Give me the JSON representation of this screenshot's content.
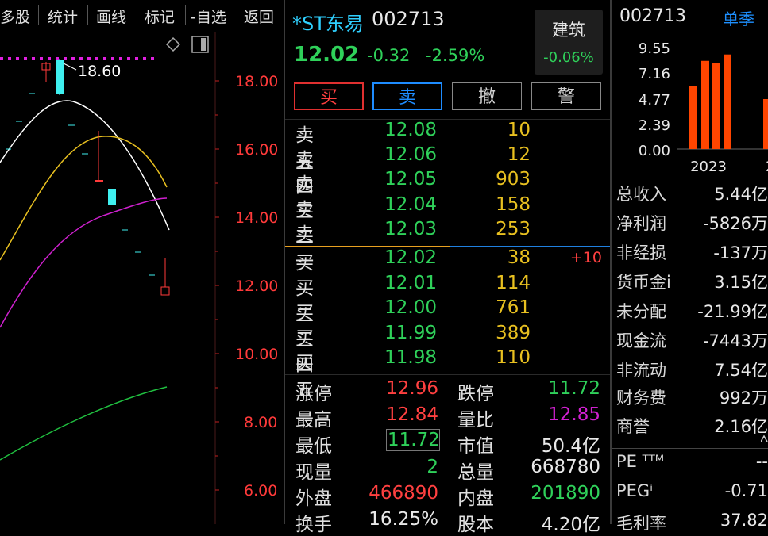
{
  "toolbar": {
    "items": [
      "多股",
      "统计",
      "画线",
      "标记",
      "-自选",
      "返回"
    ]
  },
  "kline": {
    "high_marker": "18.60",
    "y_labels": [
      "18.00",
      "16.00",
      "14.00",
      "12.00",
      "10.00",
      "8.00",
      "6.00"
    ],
    "colors": {
      "up": "#ff3a3a",
      "down": "#3ff0f0",
      "ma5": "#ffffff",
      "ma10": "#e8c020",
      "ma20": "#d020d0",
      "ma60": "#20c040",
      "limit": "#e020e0"
    }
  },
  "quote": {
    "name": "*ST东易",
    "code": "002713",
    "price": "12.02",
    "change": "-0.32",
    "change_pct": "-2.59%",
    "sector_name": "建筑",
    "sector_change": "-0.06%"
  },
  "buttons": {
    "buy": "买",
    "sell": "卖",
    "cancel": "撤",
    "alert": "警"
  },
  "asks": [
    {
      "label": "卖五",
      "price": "12.08",
      "vol": "10"
    },
    {
      "label": "卖四",
      "price": "12.06",
      "vol": "12"
    },
    {
      "label": "卖三",
      "price": "12.05",
      "vol": "903"
    },
    {
      "label": "卖二",
      "price": "12.04",
      "vol": "158"
    },
    {
      "label": "卖一",
      "price": "12.03",
      "vol": "253"
    }
  ],
  "bids": [
    {
      "label": "买一",
      "price": "12.02",
      "vol": "38",
      "delta": "+10"
    },
    {
      "label": "买二",
      "price": "12.01",
      "vol": "114",
      "delta": ""
    },
    {
      "label": "买三",
      "price": "12.00",
      "vol": "761",
      "delta": ""
    },
    {
      "label": "买四",
      "price": "11.99",
      "vol": "389",
      "delta": ""
    },
    {
      "label": "买五",
      "price": "11.98",
      "vol": "110",
      "delta": ""
    }
  ],
  "stats": {
    "limit_up_label": "涨停",
    "limit_up": "12.96",
    "limit_down_label": "跌停",
    "limit_down": "11.72",
    "high_label": "最高",
    "high": "12.84",
    "vol_ratio_label": "量比",
    "vol_ratio": "12.85",
    "low_label": "最低",
    "low": "11.72",
    "mktcap_label": "市值",
    "mktcap": "50.4亿",
    "cur_vol_label": "现量",
    "cur_vol": "2",
    "total_vol_label": "总量",
    "total_vol": "668780",
    "outer_label": "外盘",
    "outer": "466890",
    "inner_label": "内盘",
    "inner": "201890",
    "turnover_label": "换手",
    "turnover": "16.25%",
    "equity_label": "股本",
    "equity": "4.20亿"
  },
  "right_panel": {
    "code": "002713",
    "tab": "单季",
    "bar_y_labels": [
      "9.55",
      "7.16",
      "4.77",
      "2.39",
      "0.00"
    ],
    "bar_x_label": "2023",
    "bar_color": "#ff4500",
    "bar_values": [
      5.9,
      8.3,
      8.1,
      8.9,
      4.7
    ],
    "fin": [
      {
        "label": "总收入",
        "value": "5.44亿"
      },
      {
        "label": "净利润",
        "value": "-5826万"
      },
      {
        "label": "非经损",
        "value": "-137万"
      },
      {
        "label": "货币金i",
        "value": "3.15亿"
      },
      {
        "label": "未分配",
        "value": "-21.99亿"
      },
      {
        "label": "现金流",
        "value": "-7443万"
      },
      {
        "label": "非流动",
        "value": "7.54亿"
      },
      {
        "label": "财务费",
        "value": "992万"
      },
      {
        "label": "商誉",
        "value": "2.16亿"
      },
      {
        "label": "PE ᵀᵀᴹ",
        "value": "--"
      },
      {
        "label": "PEGⁱ",
        "value": "-0.71"
      },
      {
        "label": "毛利率",
        "value": "37.82"
      }
    ]
  }
}
